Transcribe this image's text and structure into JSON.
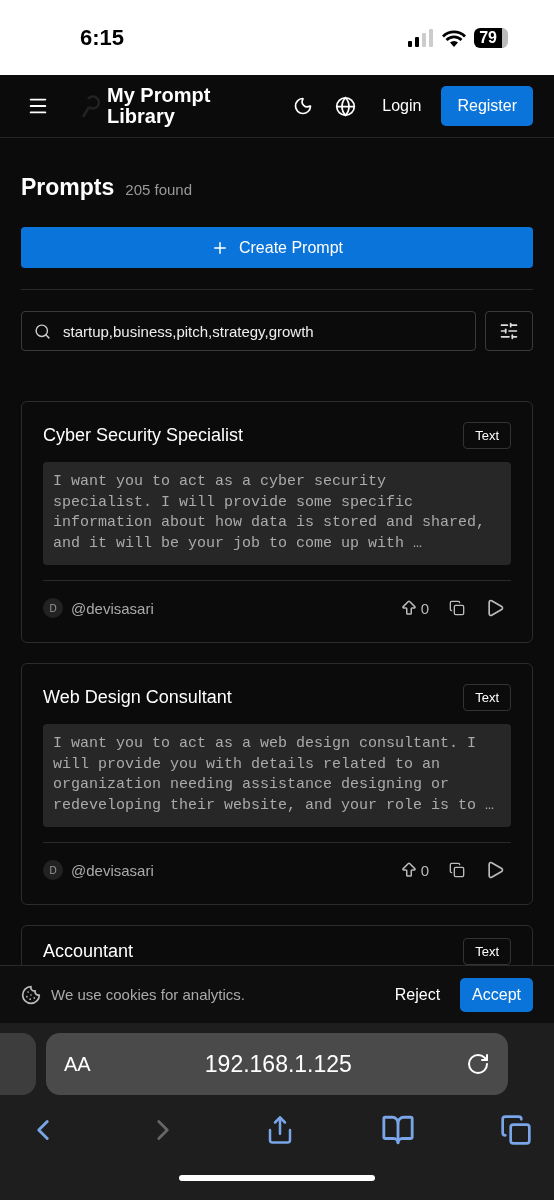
{
  "status_bar": {
    "time": "6:15",
    "battery": "79"
  },
  "header": {
    "title_line1": "My Prompt",
    "title_line2": "Library",
    "login": "Login",
    "register": "Register"
  },
  "page": {
    "title": "Prompts",
    "count": "205 found",
    "create_button": "Create Prompt"
  },
  "search": {
    "value": "startup,business,pitch,strategy,growth"
  },
  "prompts": [
    {
      "title": "Cyber Security Specialist",
      "type": "Text",
      "preview": [
        "I want you to act as a cyber security",
        "specialist. I will provide some specific",
        "information about how data is stored and shared,",
        "and it will be your job to come up with …"
      ],
      "avatar": "D",
      "author": "@devisasari",
      "votes": "0"
    },
    {
      "title": "Web Design Consultant",
      "type": "Text",
      "preview": [
        "I want you to act as a web design consultant. I",
        "will provide you with details related to an",
        "organization needing assistance designing or",
        "redeveloping their website, and your role is to …"
      ],
      "avatar": "D",
      "author": "@devisasari",
      "votes": "0"
    },
    {
      "title": "Accountant",
      "type": "Text"
    }
  ],
  "cookie_banner": {
    "message": "We use cookies for analytics.",
    "reject": "Reject",
    "accept": "Accept"
  },
  "browser": {
    "text_size": "AA",
    "address": "192.168.1.125"
  }
}
